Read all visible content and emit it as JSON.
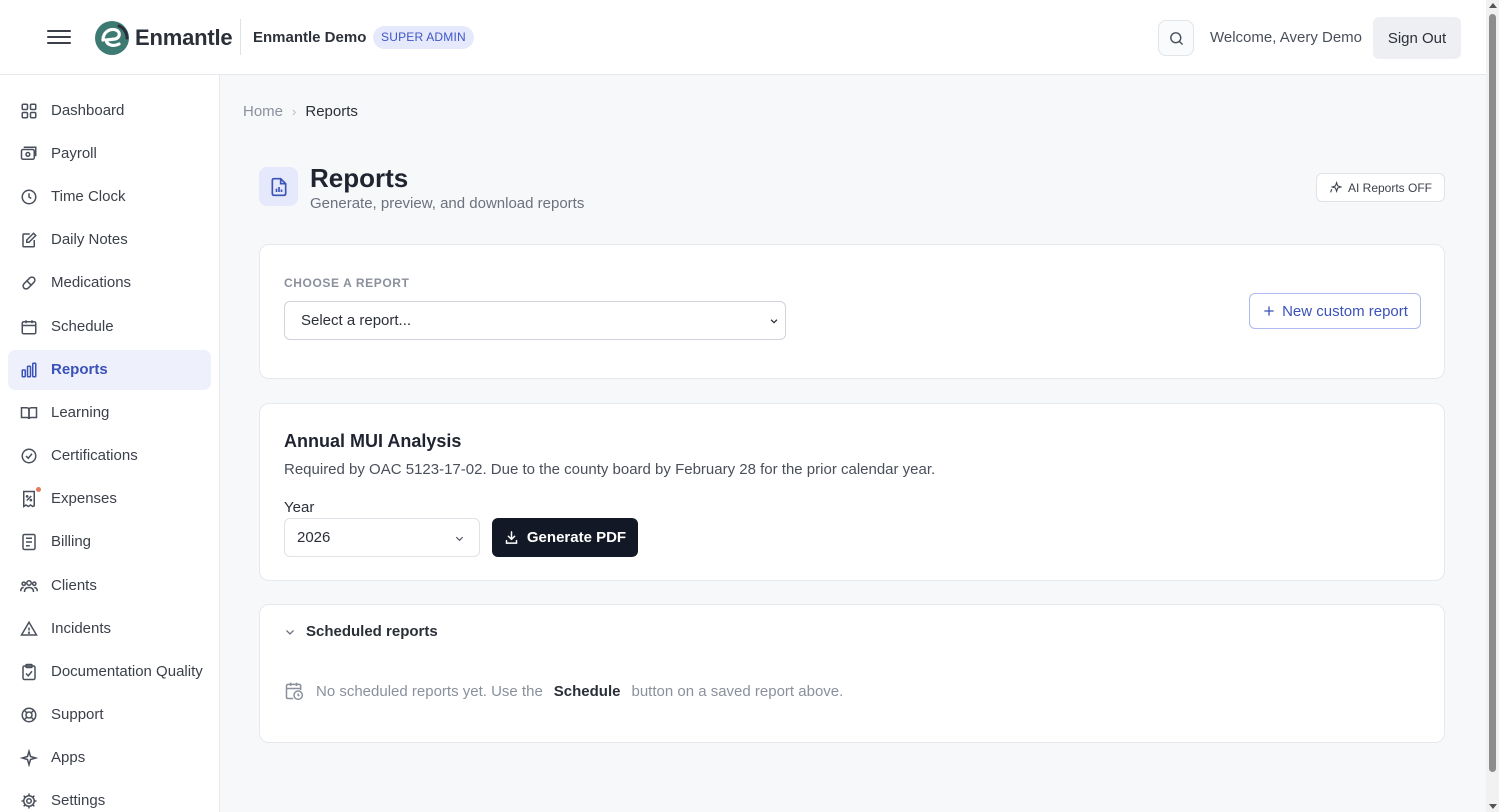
{
  "header": {
    "logo_text": "Enmantle",
    "org_name": "Enmantle Demo",
    "role_badge": "SUPER ADMIN",
    "welcome": "Welcome, Avery Demo",
    "signout_label": "Sign Out"
  },
  "sidebar": {
    "items": [
      {
        "label": "Dashboard",
        "icon": "grid-icon"
      },
      {
        "label": "Payroll",
        "icon": "wallet-icon"
      },
      {
        "label": "Time Clock",
        "icon": "clock-icon"
      },
      {
        "label": "Daily Notes",
        "icon": "notes-icon"
      },
      {
        "label": "Medications",
        "icon": "pill-icon"
      },
      {
        "label": "Schedule",
        "icon": "calendar-icon"
      },
      {
        "label": "Reports",
        "icon": "bar-chart-icon",
        "active": true
      },
      {
        "label": "Learning",
        "icon": "book-icon"
      },
      {
        "label": "Certifications",
        "icon": "check-circle-icon"
      },
      {
        "label": "Expenses",
        "icon": "receipt-icon"
      },
      {
        "label": "Billing",
        "icon": "document-icon"
      },
      {
        "label": "Clients",
        "icon": "users-icon"
      },
      {
        "label": "Incidents",
        "icon": "alert-icon"
      },
      {
        "label": "Documentation Quality",
        "icon": "clipboard-check-icon"
      },
      {
        "label": "Support",
        "icon": "lifebuoy-icon"
      },
      {
        "label": "Apps",
        "icon": "sparkle-icon"
      },
      {
        "label": "Settings",
        "icon": "gear-icon"
      }
    ]
  },
  "breadcrumb": {
    "home": "Home",
    "current": "Reports"
  },
  "page": {
    "title": "Reports",
    "subtitle": "Generate, preview, and download reports",
    "ai_button": "AI Reports OFF"
  },
  "chooser": {
    "label": "CHOOSE A REPORT",
    "select_value": "Select a report...",
    "new_button": "New custom report"
  },
  "mui": {
    "title": "Annual MUI Analysis",
    "description": "Required by OAC 5123-17-02. Due to the county board by February 28 for the prior calendar year.",
    "year_label": "Year",
    "year_value": "2026",
    "generate_button": "Generate PDF"
  },
  "scheduled": {
    "title": "Scheduled reports",
    "empty_before": "No scheduled reports yet. Use the",
    "empty_bold": "Schedule",
    "empty_after": "button on a saved report above."
  },
  "colors": {
    "accent": "#3b52b8",
    "active_bg": "#eef1fc",
    "primary_button": "#131826",
    "logo_teal": "#3d7a72"
  }
}
